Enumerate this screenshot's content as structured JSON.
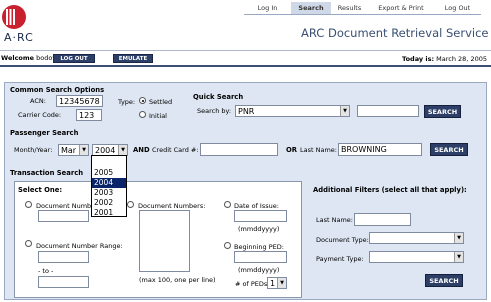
{
  "app": {
    "logo_text": "A·RC",
    "title": "ARC Document Retrieval Service"
  },
  "nav": [
    {
      "label": "Log In"
    },
    {
      "label": "Search"
    },
    {
      "label": "Results"
    },
    {
      "label": "Export & Print"
    },
    {
      "label": "Log Out"
    }
  ],
  "welcome": {
    "prefix": "Welcome",
    "user": "bodowd",
    "logout_label": "LOG OUT",
    "emulate_label": "EMULATE"
  },
  "today": {
    "prefix": "Today is:",
    "date": "March 28, 2005"
  },
  "common": {
    "title": "Common Search Options",
    "acn_label": "ACN:",
    "acn_value": "12345678",
    "carrier_label": "Carrier Code:",
    "carrier_value": "123",
    "type_label": "Type:",
    "settled_label": "Settled",
    "initial_label": "Initial"
  },
  "quick": {
    "title": "Quick Search",
    "search_by_label": "Search by:",
    "search_by_value": "PNR",
    "button": "SEARCH"
  },
  "passenger": {
    "title": "Passenger Search",
    "month_year_label": "Month/Year:",
    "month_value": "Mar",
    "year_value": "2004",
    "and_label": "AND",
    "cc_label": "Credit Card #:",
    "or_label": "OR",
    "last_name_label": "Last Name:",
    "last_name_value": "BROWNING",
    "button": "SEARCH"
  },
  "year_options": [
    "2005",
    "2004",
    "2003",
    "2002",
    "2001"
  ],
  "transaction": {
    "title": "Transaction Search",
    "select_one": "Select One:",
    "doc_number_label": "Document Number:",
    "doc_numbers_label": "Document Numbers:",
    "doc_numbers_hint": "(max 100, one per line)",
    "doc_range_label": "Document Number Range:",
    "to_label": "- to -",
    "date_issue_label": "Date of Issue:",
    "date_format": "(mmddyyyy)",
    "beginning_ped_label": "Beginning PED:",
    "num_peds_label": "# of PEDs",
    "num_peds_value": "1"
  },
  "filters": {
    "title": "Additional Filters (select all that apply):",
    "last_name_label": "Last Name:",
    "doc_type_label": "Document Type:",
    "payment_type_label": "Payment Type:",
    "button": "SEARCH"
  }
}
